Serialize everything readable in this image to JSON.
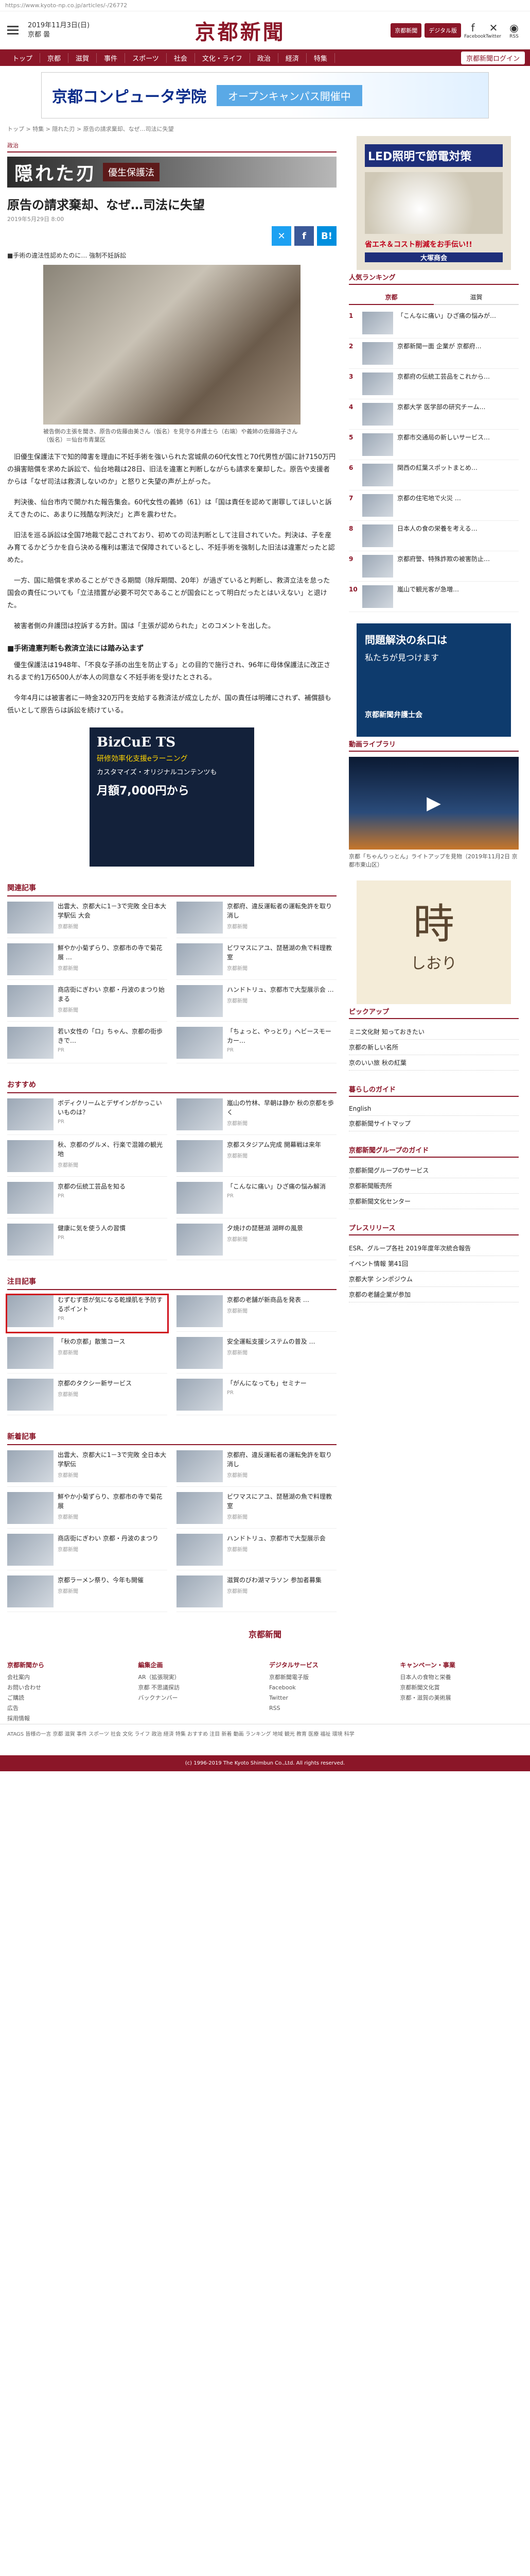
{
  "url": "https://www.kyoto-np.co.jp/articles/-/26772",
  "header": {
    "date": "2019年11月3日(日)",
    "weather": "京都 曇",
    "logo": "京都新聞",
    "subscribe_label": "京都新聞",
    "digital_label": "デジタル版",
    "facebook_label": "Facebook",
    "twitter_label": "Twitter",
    "rss_label": "RSS"
  },
  "nav": [
    "トップ",
    "京都",
    "滋賀",
    "事件",
    "スポーツ",
    "社会",
    "文化・ライフ",
    "政治",
    "経済",
    "特集"
  ],
  "nav_login": "京都新聞ログイン",
  "top_ad": {
    "title": "京都コンピュータ学院",
    "cta": "オープンキャンパス開催中"
  },
  "breadcrumb": "トップ > 特集 > 隠れた刃 > 原告の請求棄却、なぜ…司法に失望",
  "article": {
    "genre": "政治",
    "series_title": "隠れた刃",
    "series_tag": "優生保護法",
    "headline": "原告の請求棄却、なぜ…司法に失望",
    "date": "2019年5月29日 8:00",
    "lede": "■手術の違法性認めたのに… 強制不妊訴訟",
    "caption": "被告側の主張を聞き、原告の佐藤由美さん（仮名）を見守る弁護士ら（右端）や義姉の佐藤路子さん（仮名）＝仙台市青葉区",
    "paragraphs": [
      "旧優生保護法下で知的障害を理由に不妊手術を強いられた宮城県の60代女性と70代男性が国に計7150万円の損害賠償を求めた訴訟で、仙台地裁は28日、旧法を違憲と判断しながらも請求を棄却した。原告や支援者からは「なぜ司法は救済しないのか」と怒りと失望の声が上がった。",
      "判決後、仙台市内で開かれた報告集会。60代女性の義姉（61）は「国は責任を認めて謝罪してほしいと訴えてきたのに、あまりに残酷な判決だ」と声を震わせた。",
      "旧法を巡る訴訟は全国7地裁で起こされており、初めての司法判断として注目されていた。判決は、子を産み育てるかどうかを自ら決める権利は憲法で保障されているとし、不妊手術を強制した旧法は違憲だったと認めた。",
      "一方、国に賠償を求めることができる期間（除斥期間、20年）が過ぎていると判断し、救済立法を怠った国会の責任についても「立法措置が必要不可欠であることが国会にとって明白だったとはいえない」と退けた。",
      "被害者側の弁護団は控訴する方針。国は「主張が認められた」とのコメントを出した。"
    ],
    "subhead": "■手術違憲判断も救済立法には踏み込まず",
    "paragraphs2": [
      "優生保護法は1948年、「不良な子孫の出生を防止する」との目的で施行され、96年に母体保護法に改正されるまで約1万6500人が本人の同意なく不妊手術を受けたとされる。",
      "今年4月には被害者に一時金320万円を支給する救済法が成立したが、国の責任は明確にされず、補償額も低いとして原告らは訴訟を続けている。"
    ]
  },
  "mid_ad": {
    "brand": "BizCuE TS",
    "sub": "研修効率化支援eラーニング",
    "copy": "カスタマイズ・オリジナルコンテンツも",
    "price": "月額7,000円から"
  },
  "related": {
    "title": "関連記事",
    "items": [
      {
        "title": "出雲大、京都大に1－3で完敗 全日本大学駅伝 大会",
        "meta": "京都新聞"
      },
      {
        "title": "京都府、違反運転者の運転免許を取り消し",
        "meta": "京都新聞"
      },
      {
        "title": "鮮やか小菊ずらり、京都市の寺で菊花展 …",
        "meta": "京都新聞"
      },
      {
        "title": "ビワマスにアユ、琵琶湖の魚で料理教室",
        "meta": "京都新聞"
      },
      {
        "title": "商店街にぎわい 京都・丹波のまつり始まる",
        "meta": "京都新聞"
      },
      {
        "title": "ハンドトリュ、京都市で大型展示会 …",
        "meta": "京都新聞"
      },
      {
        "title": "若い女性の「ロ」ちゃん、京都の街歩きで…",
        "meta": "PR"
      },
      {
        "title": "「ちょっと、やっとり」ヘビースモーカー…",
        "meta": "PR"
      }
    ]
  },
  "recommend": {
    "title": "おすすめ",
    "items": [
      {
        "title": "ボディクリームとデザインがかっこいいものは？",
        "meta": "PR"
      },
      {
        "title": "嵐山の竹林、早朝は静か 秋の京都を歩く",
        "meta": "京都新聞"
      },
      {
        "title": "秋、京都のグルメ、行楽で混雑の観光地",
        "meta": "京都新聞"
      },
      {
        "title": "京都スタジアム完成 開幕戦は来年",
        "meta": "京都新聞"
      },
      {
        "title": "京都の伝統工芸品を知る",
        "meta": "PR"
      },
      {
        "title": "「こんなに痛い」ひざ痛の悩み解消",
        "meta": "PR"
      },
      {
        "title": "健康に気を使う人の習慣",
        "meta": "PR"
      },
      {
        "title": "夕焼けの琵琶湖 湖畔の風景",
        "meta": "京都新聞"
      }
    ]
  },
  "attention": {
    "title": "注目記事",
    "items": [
      {
        "title": "むずむず感が気になる乾燥肌を予防するポイント",
        "meta": "PR"
      },
      {
        "title": "京都の老舗が新商品を発表 …",
        "meta": "京都新聞"
      },
      {
        "title": "「秋の京都」散策コース",
        "meta": "京都新聞"
      },
      {
        "title": "安全運転支援システムの普及 …",
        "meta": "京都新聞"
      },
      {
        "title": "京都のタクシー新サービス",
        "meta": "京都新聞"
      },
      {
        "title": "「がんになっても」セミナー",
        "meta": "PR"
      }
    ]
  },
  "latest": {
    "title": "新着記事",
    "items": [
      {
        "title": "出雲大、京都大に1－3で完敗 全日本大学駅伝",
        "meta": "京都新聞"
      },
      {
        "title": "京都府、違反運転者の運転免許を取り消し",
        "meta": "京都新聞"
      },
      {
        "title": "鮮やか小菊ずらり、京都市の寺で菊花展",
        "meta": "京都新聞"
      },
      {
        "title": "ビワマスにアユ、琵琶湖の魚で料理教室",
        "meta": "京都新聞"
      },
      {
        "title": "商店街にぎわい 京都・丹波のまつり",
        "meta": "京都新聞"
      },
      {
        "title": "ハンドトリュ、京都市で大型展示会",
        "meta": "京都新聞"
      },
      {
        "title": "京都ラーメン祭り、今年も開催",
        "meta": "京都新聞"
      },
      {
        "title": "滋賀のびわ湖マラソン 参加者募集",
        "meta": "京都新聞"
      }
    ]
  },
  "side": {
    "ad1": {
      "line1": "LED照明で節電対策",
      "line2": "省エネ＆コスト削減をお手伝い!!",
      "brand": "大塚商会"
    },
    "ranking_title": "人気ランキング",
    "ranking_tabs": [
      "京都",
      "滋賀"
    ],
    "ranking": [
      "「こんなに痛い」ひざ痛の悩みが…",
      "京都新聞一面 企業が 京都府…",
      "京都府の伝統工芸品をこれから…",
      "京都大学 医学部の研究チーム…",
      "京都市交通局の新しいサービス…",
      "関西の紅葉スポットまとめ…",
      "京都の住宅地で火災 …",
      "日本人の食の栄養を考える…",
      "京都府警、特殊詐欺の被害防止…",
      "嵐山で観光客が急増…"
    ],
    "ad2": {
      "line1": "問題解決の糸口は",
      "line2": "私たちが見つけます",
      "brand": "京都新聞弁護士会"
    },
    "video_title": "動画ライブラリ",
    "video_caption": "京都「ちゃんりっとん」ライトアップを見物（2019年11月2日 京都市東山区）",
    "ad3": {
      "line1": "時",
      "line2": "しおり"
    },
    "pickup_title": "ピックアップ",
    "pickup": [
      "ミニ文化財 知っておきたい",
      "京都の新しい名所",
      "京のいい旅 秋の紅葉"
    ],
    "life_title": "暮らしのガイド",
    "life": [
      "English",
      "京都新聞サイトマップ"
    ],
    "group_title": "京都新聞グループのガイド",
    "group": [
      "京都新聞グループのサービス",
      "京都新聞販売所",
      "京都新聞文化センター"
    ],
    "press_title": "プレスリリース",
    "press": [
      "ESR、グループ各社 2019年度年次統合報告",
      "イベント情報 第41回",
      "京都大学 シンポジウム",
      "京都の老舗企業が参加"
    ]
  },
  "footer": {
    "cols": [
      {
        "title": "京都新聞から",
        "items": [
          "会社案内",
          "お問い合わせ",
          "ご購読",
          "広告",
          "採用情報"
        ]
      },
      {
        "title": "編集企画",
        "items": [
          "AR（拡張現実）",
          "京都 不思議探訪",
          "バックナンバー"
        ]
      },
      {
        "title": "デジタルサービス",
        "items": [
          "京都新聞電子版",
          "Facebook",
          "Twitter",
          "RSS"
        ]
      },
      {
        "title": "キャンペーン・事業",
        "items": [
          "日本人の食物と栄養",
          "京都新聞文化賞",
          "京都・滋賀の美術展"
        ]
      }
    ],
    "logo": "京都新聞",
    "tags": "ATAGS 皆様の一言 京都 滋賀 事件 スポーツ 社会 文化 ライフ 政治 経済 特集 おすすめ 注目 新着 動画 ランキング 地域 観光 教育 医療 福祉 環境 科学",
    "copyright": "(c) 1996-2019 The Kyoto Shimbun Co.,Ltd. All rights reserved."
  }
}
